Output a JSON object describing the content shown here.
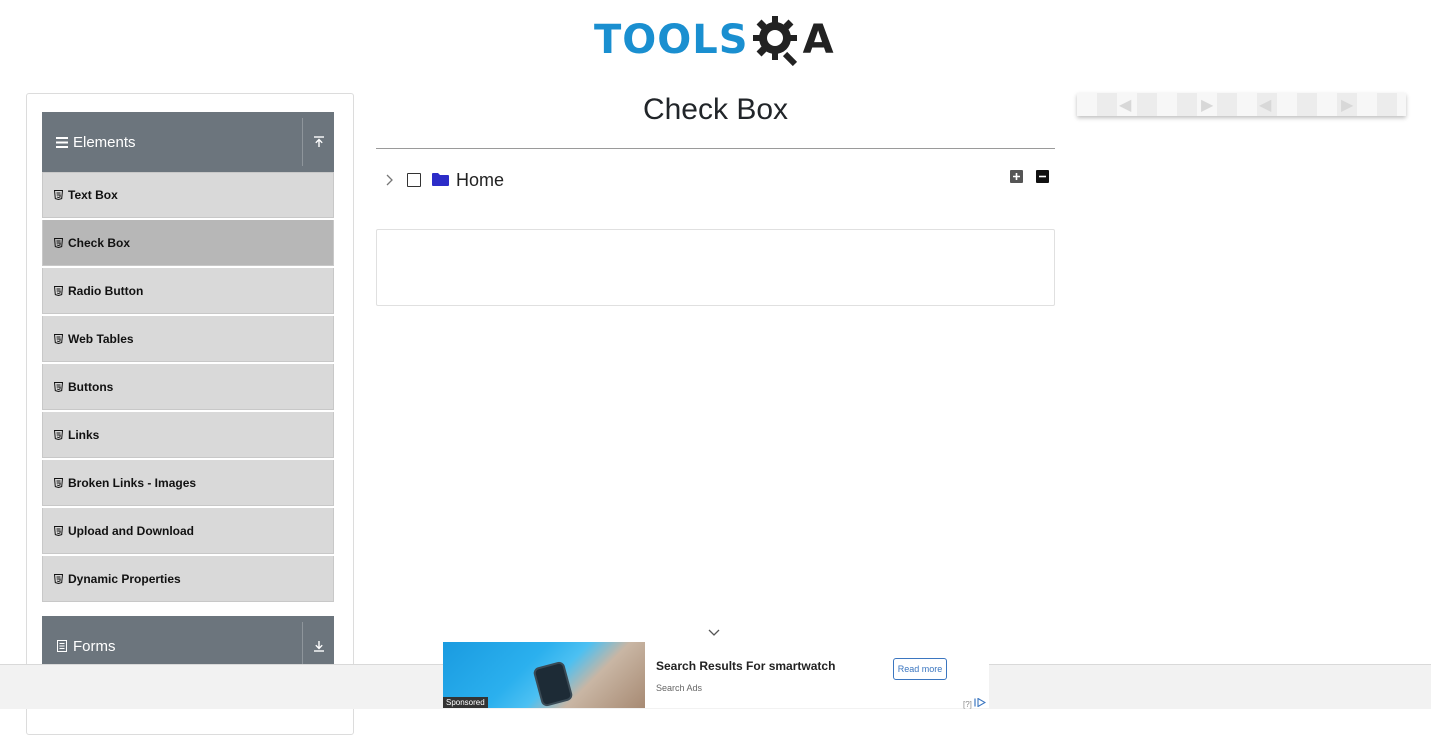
{
  "header": {
    "logo_text": "TOOLS",
    "logo_suffix": "A"
  },
  "sidebar": {
    "groups": [
      {
        "title": "Elements",
        "expanded": true
      },
      {
        "title": "Forms",
        "expanded": false
      }
    ],
    "items": [
      {
        "label": "Text Box",
        "active": false
      },
      {
        "label": "Check Box",
        "active": true
      },
      {
        "label": "Radio Button",
        "active": false
      },
      {
        "label": "Web Tables",
        "active": false
      },
      {
        "label": "Buttons",
        "active": false
      },
      {
        "label": "Links",
        "active": false
      },
      {
        "label": "Broken Links - Images",
        "active": false
      },
      {
        "label": "Upload and Download",
        "active": false
      },
      {
        "label": "Dynamic Properties",
        "active": false
      }
    ]
  },
  "main": {
    "title": "Check Box",
    "tree": {
      "root_label": "Home",
      "expanded": false,
      "checked": false
    }
  },
  "ad": {
    "title": "Search Results For smartwatch",
    "source": "Search Ads",
    "button_label": "Read more",
    "sponsored_label": "Sponsored",
    "adchoices_label": "[?]"
  },
  "colors": {
    "logo_blue": "#1a8fd0",
    "sidebar_header": "#6c757d",
    "menu_item_bg": "#d9d9d9",
    "menu_item_active_bg": "#b7b7b7",
    "folder_icon": "#2c2cc8"
  }
}
